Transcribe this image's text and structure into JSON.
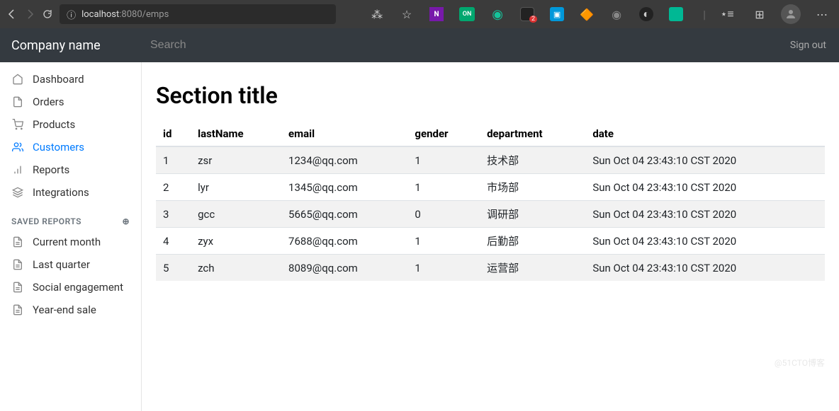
{
  "browser": {
    "url_host": "localhost",
    "url_port": ":8080",
    "url_path": "/emps"
  },
  "topbar": {
    "brand": "Company name",
    "search_placeholder": "Search",
    "signout": "Sign out"
  },
  "sidebar": {
    "items": [
      {
        "label": "Dashboard",
        "icon": "home"
      },
      {
        "label": "Orders",
        "icon": "file"
      },
      {
        "label": "Products",
        "icon": "cart"
      },
      {
        "label": "Customers",
        "icon": "users",
        "active": true
      },
      {
        "label": "Reports",
        "icon": "bar-chart"
      },
      {
        "label": "Integrations",
        "icon": "layers"
      }
    ],
    "section_title": "SAVED REPORTS",
    "reports": [
      {
        "label": "Current month"
      },
      {
        "label": "Last quarter"
      },
      {
        "label": "Social engagement"
      },
      {
        "label": "Year-end sale"
      }
    ]
  },
  "main": {
    "title": "Section title",
    "columns": [
      "id",
      "lastName",
      "email",
      "gender",
      "department",
      "date"
    ],
    "rows": [
      {
        "id": "1",
        "lastName": "zsr",
        "email": "1234@qq.com",
        "gender": "1",
        "department": "技术部",
        "date": "Sun Oct 04 23:43:10 CST 2020"
      },
      {
        "id": "2",
        "lastName": "lyr",
        "email": "1345@qq.com",
        "gender": "1",
        "department": "市场部",
        "date": "Sun Oct 04 23:43:10 CST 2020"
      },
      {
        "id": "3",
        "lastName": "gcc",
        "email": "5665@qq.com",
        "gender": "0",
        "department": "调研部",
        "date": "Sun Oct 04 23:43:10 CST 2020"
      },
      {
        "id": "4",
        "lastName": "zyx",
        "email": "7688@qq.com",
        "gender": "1",
        "department": "后勤部",
        "date": "Sun Oct 04 23:43:10 CST 2020"
      },
      {
        "id": "5",
        "lastName": "zch",
        "email": "8089@qq.com",
        "gender": "1",
        "department": "运营部",
        "date": "Sun Oct 04 23:43:10 CST 2020"
      }
    ]
  },
  "watermark": "@51CTO博客"
}
